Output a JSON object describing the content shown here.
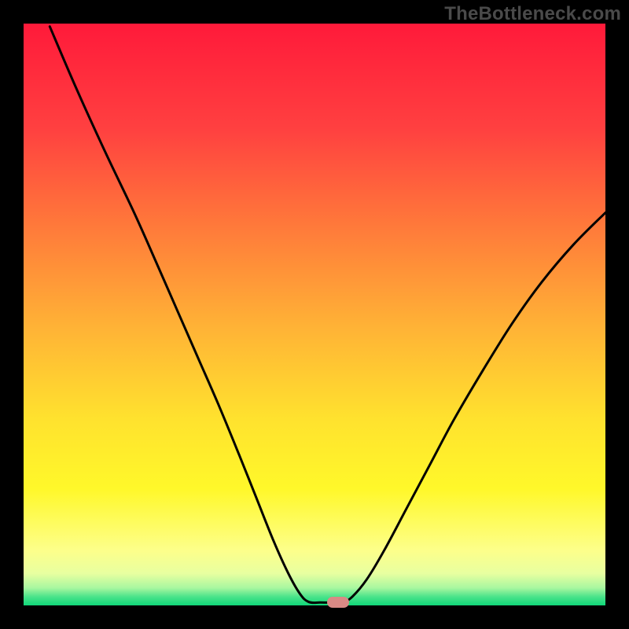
{
  "watermark": "TheBottleneck.com",
  "chart_data": {
    "type": "line",
    "title": "",
    "xlabel": "",
    "ylabel": "",
    "xlim": [
      0,
      100
    ],
    "ylim": [
      0,
      100
    ],
    "grid": false,
    "legend": false,
    "gradient_stops": [
      {
        "offset": 0.0,
        "color": "#ff1a3a"
      },
      {
        "offset": 0.18,
        "color": "#ff4040"
      },
      {
        "offset": 0.35,
        "color": "#ff7a3a"
      },
      {
        "offset": 0.52,
        "color": "#ffb236"
      },
      {
        "offset": 0.68,
        "color": "#ffe22e"
      },
      {
        "offset": 0.8,
        "color": "#fff82a"
      },
      {
        "offset": 0.905,
        "color": "#fdff8a"
      },
      {
        "offset": 0.945,
        "color": "#e8ffa0"
      },
      {
        "offset": 0.97,
        "color": "#a8f7a0"
      },
      {
        "offset": 0.985,
        "color": "#4be38a"
      },
      {
        "offset": 1.0,
        "color": "#10d779"
      }
    ],
    "series": [
      {
        "name": "bottleneck-curve",
        "stroke": "#000000",
        "stroke_width": 3,
        "points": [
          {
            "x": 4.5,
            "y": 99.5
          },
          {
            "x": 9.0,
            "y": 89.0
          },
          {
            "x": 14.0,
            "y": 78.0
          },
          {
            "x": 19.0,
            "y": 67.5
          },
          {
            "x": 23.0,
            "y": 58.5
          },
          {
            "x": 26.5,
            "y": 50.5
          },
          {
            "x": 30.0,
            "y": 42.5
          },
          {
            "x": 33.5,
            "y": 34.5
          },
          {
            "x": 37.0,
            "y": 26.0
          },
          {
            "x": 40.0,
            "y": 18.5
          },
          {
            "x": 43.0,
            "y": 11.0
          },
          {
            "x": 45.5,
            "y": 5.5
          },
          {
            "x": 47.5,
            "y": 2.0
          },
          {
            "x": 49.0,
            "y": 0.6
          },
          {
            "x": 51.0,
            "y": 0.5
          },
          {
            "x": 53.0,
            "y": 0.5
          },
          {
            "x": 54.8,
            "y": 0.5
          },
          {
            "x": 56.5,
            "y": 1.5
          },
          {
            "x": 59.0,
            "y": 4.5
          },
          {
            "x": 62.0,
            "y": 9.5
          },
          {
            "x": 66.0,
            "y": 17.0
          },
          {
            "x": 70.0,
            "y": 24.5
          },
          {
            "x": 74.0,
            "y": 32.0
          },
          {
            "x": 79.0,
            "y": 40.5
          },
          {
            "x": 84.0,
            "y": 48.5
          },
          {
            "x": 89.0,
            "y": 55.5
          },
          {
            "x": 94.5,
            "y": 62.0
          },
          {
            "x": 100.0,
            "y": 67.5
          }
        ]
      }
    ],
    "marker": {
      "x": 54.0,
      "y": 0.5,
      "color": "#d98a85",
      "shape": "pill"
    }
  }
}
